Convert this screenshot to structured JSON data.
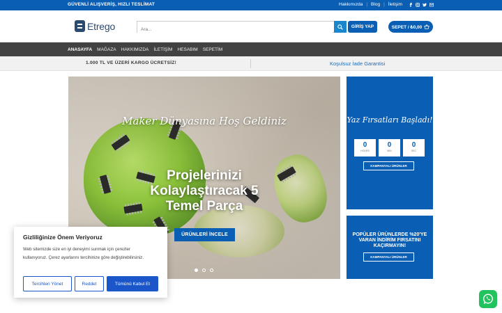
{
  "topbar": {
    "tagline": "GÜVENLİ ALIŞVERİŞ, HIZLI TESLİMAT",
    "links": [
      "Hakkımızda",
      "Blog",
      "İletişim"
    ],
    "social_icons": [
      "facebook-icon",
      "instagram-icon",
      "twitter-icon",
      "mail-icon"
    ]
  },
  "header": {
    "logo_text": "Etrego",
    "search_placeholder": "Ara...",
    "login_label": "GİRİŞ YAP",
    "cart_label": "SEPET / ₺0,00"
  },
  "nav": {
    "items": [
      "ANASAYFA",
      "MAĞAZA",
      "HAKKIMIZDA",
      "İLETİŞİM",
      "HESABIM",
      "SEPETİM"
    ],
    "active": "ANASAYFA"
  },
  "strip": {
    "left_text": "1.000 TL VE ÜZERİ KARGO ÜCRETSİZ!",
    "right_text": "Koşulsuz İade Garantisi"
  },
  "hero": {
    "kicker": "Maker Dünyasına Hoş Geldiniz",
    "headline": "Projelerinizi Kolaylaştıracak 5 Temel Parça",
    "cta_label": "ÜRÜNLERİ İNCELE",
    "slide_count": 3,
    "active_slide": 1
  },
  "promo_countdown": {
    "title": "Yaz Fırsatları Başladı!",
    "hours": "0",
    "hours_label": "HOURS",
    "min": "0",
    "min_label": "MIN",
    "sec": "0",
    "sec_label": "SEC",
    "button_label": "KAMPANYALI ÜRÜNLER"
  },
  "promo_discount": {
    "title": "POPÜLER ÜRÜNLERDE %20'YE VARAN İNDİRİM FIRSATINI KAÇIRMAYIN!",
    "button_label": "KAMPANYALI ÜRÜNLER"
  },
  "cookie": {
    "title": "Gizliliğinize Önem Veriyoruz",
    "text": "Web sitemizde size en iyi deneyimi sunmak için çerezler kullanıyoruz. Çerez ayarlarını tercihinize göre değiştirebilirsiniz.",
    "manage_label": "Tercihleri Yönet",
    "reject_label": "Reddet",
    "accept_label": "Tümünü Kabul Et"
  },
  "colors": {
    "brand_blue": "#0a5fb4",
    "nav_bg": "#424242",
    "whatsapp_green": "#22c25e"
  }
}
